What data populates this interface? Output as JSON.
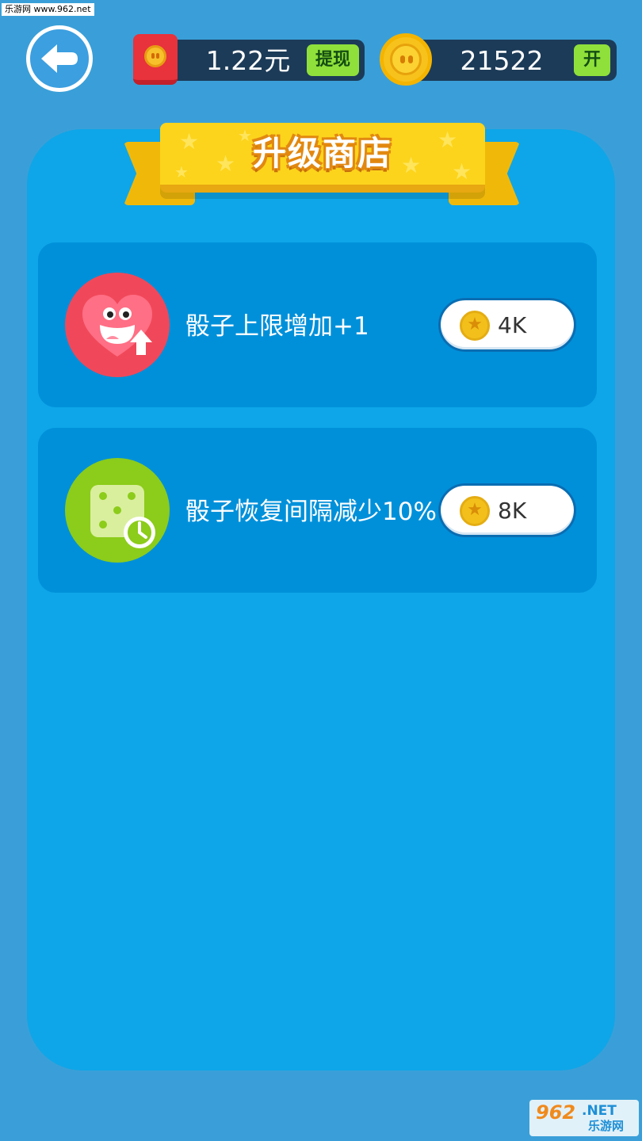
{
  "watermark": {
    "top_text": "乐游网 www.962.net",
    "bottom_number": "962",
    "bottom_domain": ".NET",
    "bottom_cn": "乐游网"
  },
  "header": {
    "back_icon": "arrow-left-icon",
    "cash": {
      "icon": "red-envelope-icon",
      "value": "1.22元",
      "action_label": "提现"
    },
    "coins": {
      "icon": "coin-icon",
      "value": "21522",
      "action_label": "开"
    }
  },
  "panel": {
    "title": "升级商店"
  },
  "shop_items": [
    {
      "title": "骰子上限增加+1",
      "icon": "heart-upgrade-icon",
      "price": "4K",
      "price_icon": "coin-icon"
    },
    {
      "title": "骰子恢复间隔减少10%",
      "icon": "dice-clock-icon",
      "price": "8K",
      "price_icon": "coin-icon"
    }
  ],
  "colors": {
    "background": "#3a9fd8",
    "panel": "#0ea6e8",
    "card": "#0090da",
    "accent_green": "#8fe03a",
    "banner_yellow": "#fcd41c"
  }
}
